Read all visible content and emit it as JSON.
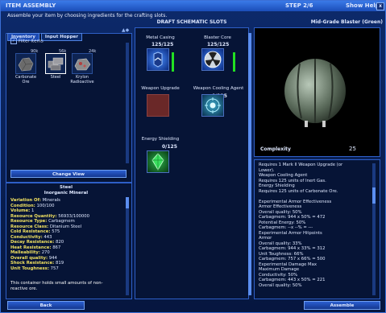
{
  "window": {
    "title": "ITEM ASSEMBLY",
    "step": "STEP 2/6",
    "help": "Show Help",
    "close": "x"
  },
  "instructions": "Assemble your item by choosing ingredients for the crafting slots.",
  "tabs": [
    "Inventory",
    "Input Hopper"
  ],
  "filter_label": "Filter Items",
  "inventory": [
    {
      "qty": "90k",
      "label": "Carbonate Ore"
    },
    {
      "qty": "56k",
      "label": "Steel"
    },
    {
      "qty": "24k",
      "label": "Krylon Radioactive"
    }
  ],
  "change_view": "Change View",
  "resource": {
    "name": "Steel",
    "type": "Inorganic Mineral",
    "rows": [
      [
        "Variation Of:",
        "Minerals"
      ],
      [
        "Condition:",
        "100/100"
      ],
      [
        "Volume:",
        "1"
      ],
      [
        "Resource Quantity:",
        "56933/100000"
      ],
      [
        "Resource Type:",
        "Carbagmem"
      ],
      [
        "Resource Class:",
        "Ditanium Steel"
      ],
      [
        "Cold Resistance:",
        "575"
      ],
      [
        "Conductivity:",
        "443"
      ],
      [
        "Decay Resistance:",
        "820"
      ],
      [
        "Heat Resistance:",
        "867"
      ],
      [
        "Malleability:",
        "270"
      ],
      [
        "Overall quality:",
        "944"
      ],
      [
        "Shock Resistance:",
        "819"
      ],
      [
        "Unit Toughness:",
        "757"
      ]
    ],
    "note1": "This container holds small amounts of non-",
    "note2": "reactive ore."
  },
  "schematic_title": "DRAFT SCHEMATIC SLOTS",
  "slots": [
    {
      "label": "Metal Casing",
      "count": "125/125",
      "color": "#2b6be0",
      "fill": 1.0
    },
    {
      "label": "Blaster Core",
      "count": "125/125",
      "color": "#3a80f0",
      "fill": 1.0
    },
    {
      "label": "Weapon Upgrade",
      "count": "",
      "color": "#7a2a2a",
      "fill": 0
    },
    {
      "label": "Weapon Cooling Agent",
      "count": "0/125",
      "color": "#2a8a9a",
      "fill": 0
    },
    {
      "label": "Energy Shielding",
      "count": "0/125",
      "color": "#1a7a2a",
      "fill": 0
    }
  ],
  "item_title": "Mid-Grade Blaster (Green)",
  "complexity_label": "Complexity",
  "complexity_value": "25",
  "description": [
    {
      "t": "Requires 1 Mark II Weapon Upgrade (or",
      "c": "w"
    },
    {
      "t": "   Lower).",
      "c": "w"
    },
    {
      "t": "Weapon Cooling Agent",
      "c": "w"
    },
    {
      "t": "   Requires 125 units of Inert Gas.",
      "c": "w"
    },
    {
      "t": "Energy Shielding",
      "c": "w"
    },
    {
      "t": "   Requires 125 units of Carbonate Ore.",
      "c": "w"
    },
    {
      "t": "",
      "c": ""
    },
    {
      "t": "Experimental Armor Effectiveness",
      "c": "w"
    },
    {
      "t": " Armor Effectiveness",
      "c": "h"
    },
    {
      "t": "   Overall quality:          50%",
      "c": "w"
    },
    {
      "t": "   Carbagmem:          944 x 50% = 472",
      "c": "g"
    },
    {
      "t": "   Potential Energy:      50%",
      "c": "w"
    },
    {
      "t": "   Carbagmem:          --x --% = ---",
      "c": "w"
    },
    {
      "t": "Experimental Armor Hitpoints",
      "c": "w"
    },
    {
      "t": " Armor",
      "c": "h"
    },
    {
      "t": "   Overall quality:          33%",
      "c": "w"
    },
    {
      "t": "   Carbagmem:          944 x 33% = 312",
      "c": "g"
    },
    {
      "t": "   Unit Toughness:         66%",
      "c": "w"
    },
    {
      "t": "   Carbagmem:          757 x 66% = 500",
      "c": "g"
    },
    {
      "t": "Experimental Damage Max",
      "c": "w"
    },
    {
      "t": " Maximum Damage",
      "c": "h"
    },
    {
      "t": "   Conductivity:              50%",
      "c": "w"
    },
    {
      "t": "   Carbagmem:          443 x 50% = 221",
      "c": "g"
    },
    {
      "t": "   Overall quality:          50%",
      "c": "w"
    }
  ],
  "back_label": "Back",
  "assemble_label": "Assemble"
}
